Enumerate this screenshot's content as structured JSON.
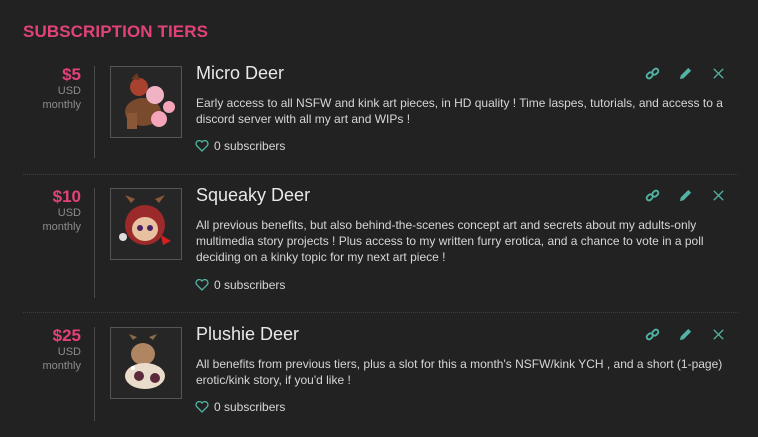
{
  "section_title": "SUBSCRIPTION TIERS",
  "colors": {
    "accent": "#e2427a",
    "teal": "#52b3a4",
    "bg": "#222222"
  },
  "tiers": [
    {
      "price": "$5",
      "currency": "USD",
      "period": "monthly",
      "name": "Micro Deer",
      "description": "Early access to all NSFW and kink art pieces, in HD quality ! Time laspes, tutorials, and access to a discord server with all my art and WIPs !",
      "subscribers": "0 subscribers"
    },
    {
      "price": "$10",
      "currency": "USD",
      "period": "monthly",
      "name": "Squeaky Deer",
      "description": "All previous benefits, but also behind-the-scenes concept art and secrets about my adults-only multimedia story projects ! Plus access to my written furry erotica, and a chance to vote in a poll deciding on a kinky topic for my next art piece !",
      "subscribers": "0 subscribers"
    },
    {
      "price": "$25",
      "currency": "USD",
      "period": "monthly",
      "name": "Plushie Deer",
      "description": "All benefits from previous tiers, plus a slot for this a month's NSFW/kink YCH , and a short (1-page) erotic/kink story, if you'd like !",
      "subscribers": "0 subscribers"
    }
  ],
  "icons": {
    "link": "link-icon",
    "edit": "pencil-icon",
    "delete": "close-icon",
    "subscribers": "heart-icon"
  }
}
